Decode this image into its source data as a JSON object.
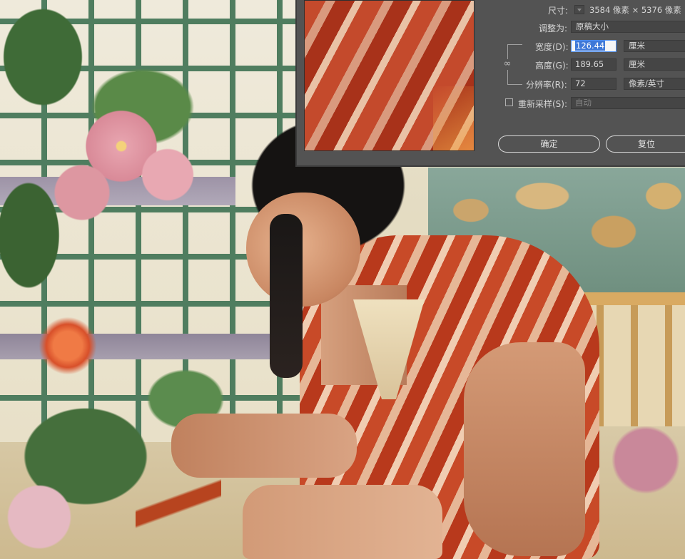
{
  "dialog": {
    "dimensions_label": "尺寸:",
    "dimensions_value": "3584 像素 × 5376 像素",
    "fit_to_label": "调整为:",
    "fit_to_value": "原稿大小",
    "width_label": "宽度(D):",
    "width_value": "126.44",
    "width_unit": "厘米",
    "height_label": "高度(G):",
    "height_value": "189.65",
    "height_unit": "厘米",
    "resolution_label": "分辨率(R):",
    "resolution_value": "72",
    "resolution_unit": "像素/英寸",
    "resample_label": "重新采样(S):",
    "resample_value": "自动",
    "resample_checked": false,
    "ok_button": "确定",
    "reset_button": "复位"
  },
  "colors": {
    "dialog_bg": "#535353",
    "field_bg": "#454545",
    "selection_blue": "#3e78d8"
  },
  "icons": {
    "link": "chain-link-icon",
    "dropdown": "chevron-down-icon"
  }
}
